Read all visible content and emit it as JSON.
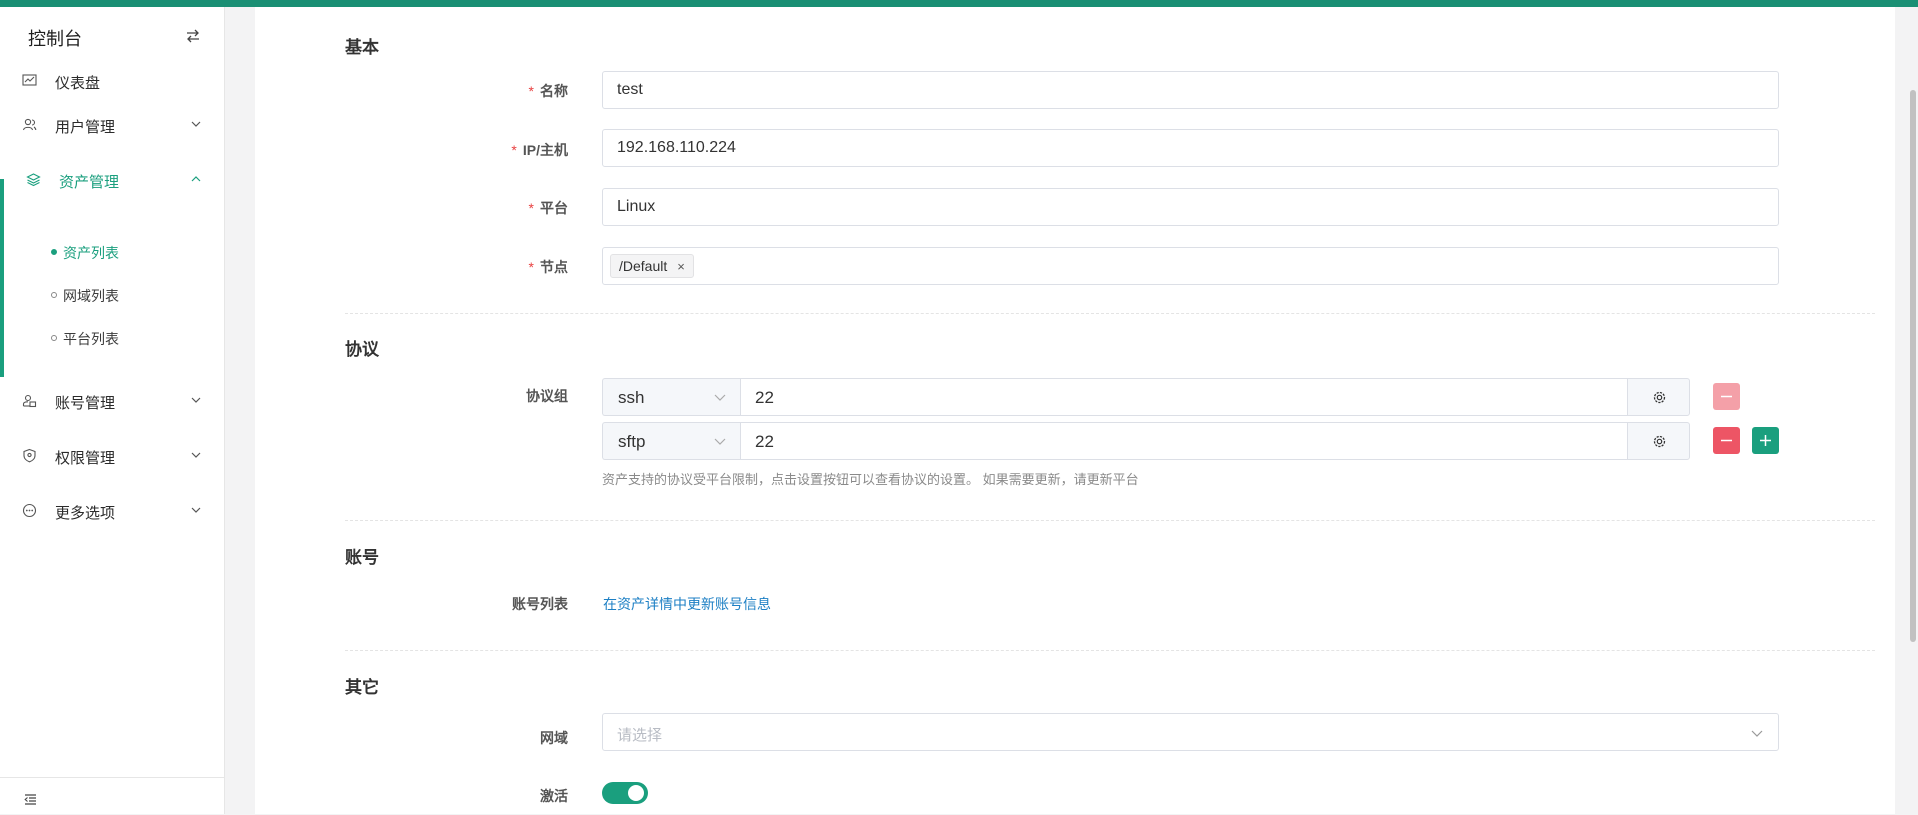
{
  "sidebar": {
    "title": "控制台",
    "menu": {
      "dashboard": "仪表盘",
      "users": "用户管理",
      "assets": "资产管理",
      "accounts": "账号管理",
      "permissions": "权限管理",
      "more": "更多选项"
    },
    "submenu": {
      "asset_list": "资产列表",
      "domain_list": "网域列表",
      "platform_list": "平台列表"
    }
  },
  "form": {
    "sections": {
      "basic": "基本",
      "protocol": "协议",
      "account": "账号",
      "other": "其它"
    },
    "required_mark": "*",
    "fields": {
      "name": {
        "label": "名称",
        "value": "test"
      },
      "host": {
        "label": "IP/主机",
        "value": "192.168.110.224"
      },
      "platform": {
        "label": "平台",
        "value": "Linux"
      },
      "nodes": {
        "label": "节点",
        "tags": [
          "/Default"
        ]
      },
      "protocols": {
        "label": "协议组",
        "rows": [
          {
            "name": "ssh",
            "port": "22"
          },
          {
            "name": "sftp",
            "port": "22"
          }
        ],
        "hint": "资产支持的协议受平台限制，点击设置按钮可以查看协议的设置。 如果需要更新，请更新平台"
      },
      "account_list": {
        "label": "账号列表",
        "link": "在资产详情中更新账号信息"
      },
      "domain": {
        "label": "网域",
        "placeholder": "请选择"
      },
      "active": {
        "label": "激活",
        "value": true
      }
    }
  },
  "colors": {
    "brand": "#1a9f7e",
    "topbar": "#1a8f74",
    "danger": "#ed5565",
    "danger_light": "#f4a0a8",
    "link": "#1c7fc4"
  }
}
